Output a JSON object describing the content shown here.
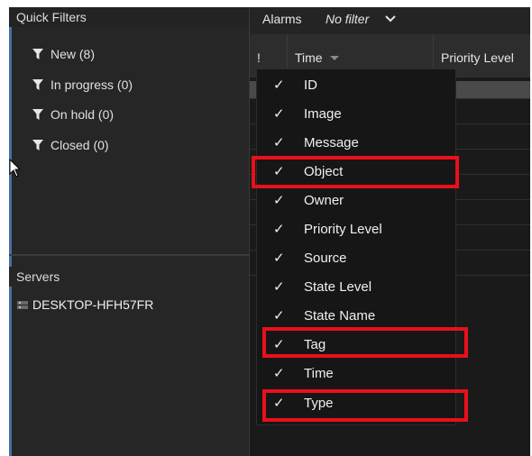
{
  "quick_filters": {
    "title": "Quick Filters",
    "items": [
      {
        "label": "New (8)",
        "icon": "funnel-icon"
      },
      {
        "label": "In progress (0)",
        "icon": "funnel-icon"
      },
      {
        "label": "On hold (0)",
        "icon": "funnel-icon"
      },
      {
        "label": "Closed (0)",
        "icon": "funnel-icon"
      }
    ]
  },
  "servers": {
    "title": "Servers",
    "items": [
      {
        "label": "DESKTOP-HFH57FR",
        "icon": "server-icon"
      }
    ]
  },
  "alarms": {
    "title": "Alarms",
    "filter": "No filter"
  },
  "columns": {
    "flag": "!",
    "time": "Time",
    "priority": "Priority Level"
  },
  "column_menu": {
    "check_glyph": "✓",
    "items": [
      {
        "label": "ID",
        "checked": true
      },
      {
        "label": "Image",
        "checked": true
      },
      {
        "label": "Message",
        "checked": true
      },
      {
        "label": "Object",
        "checked": true,
        "highlighted": true
      },
      {
        "label": "Owner",
        "checked": true
      },
      {
        "label": "Priority Level",
        "checked": true
      },
      {
        "label": "Source",
        "checked": true
      },
      {
        "label": "State Level",
        "checked": true
      },
      {
        "label": "State Name",
        "checked": true
      },
      {
        "label": "Tag",
        "checked": true,
        "highlighted": true
      },
      {
        "label": "Time",
        "checked": true
      },
      {
        "label": "Type",
        "checked": true,
        "highlighted": true
      }
    ]
  },
  "colors": {
    "annotation": "#e8101a",
    "panel_bg": "#262626",
    "menu_bg": "#161616",
    "accent": "#4a6fa5"
  }
}
